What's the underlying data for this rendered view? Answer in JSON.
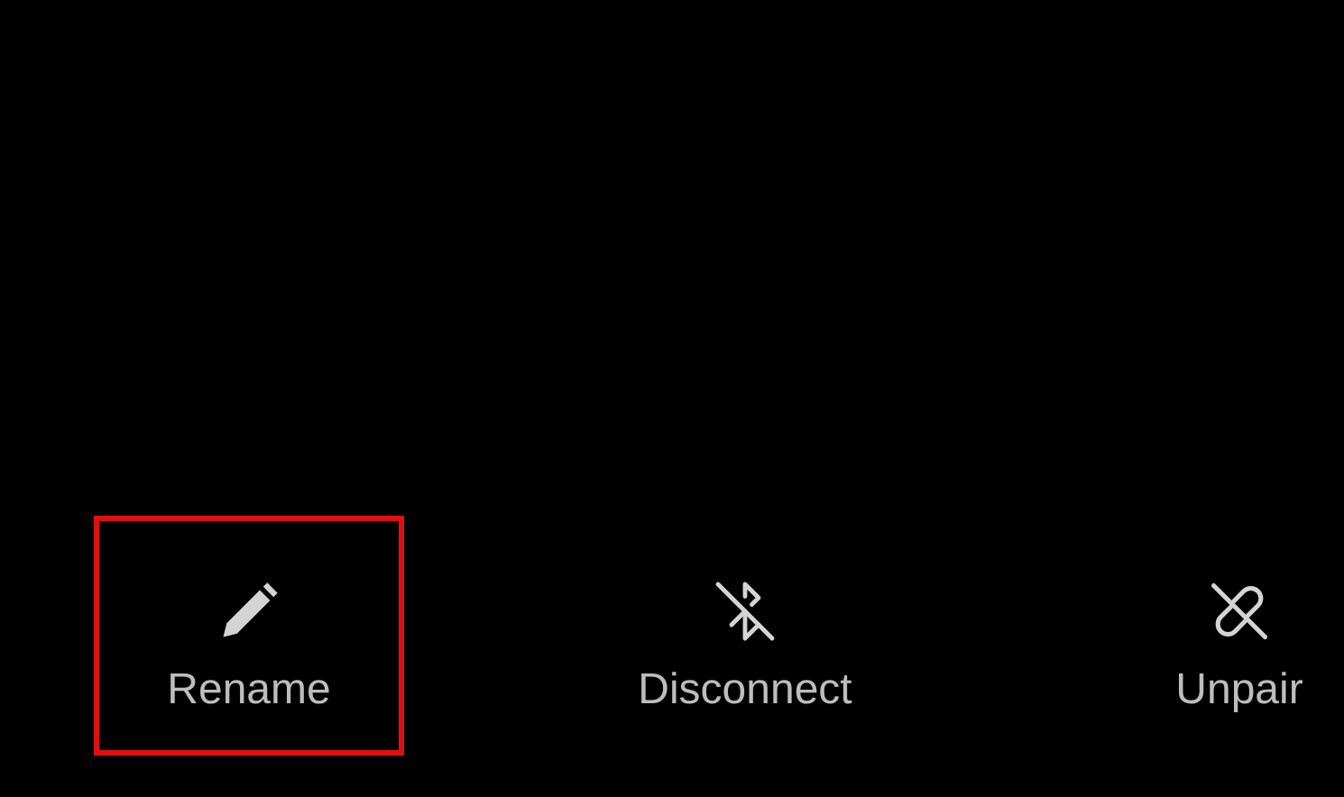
{
  "actions": [
    {
      "label": "Rename",
      "highlighted": true
    },
    {
      "label": "Disconnect",
      "highlighted": false
    },
    {
      "label": "Unpair",
      "highlighted": false
    }
  ]
}
